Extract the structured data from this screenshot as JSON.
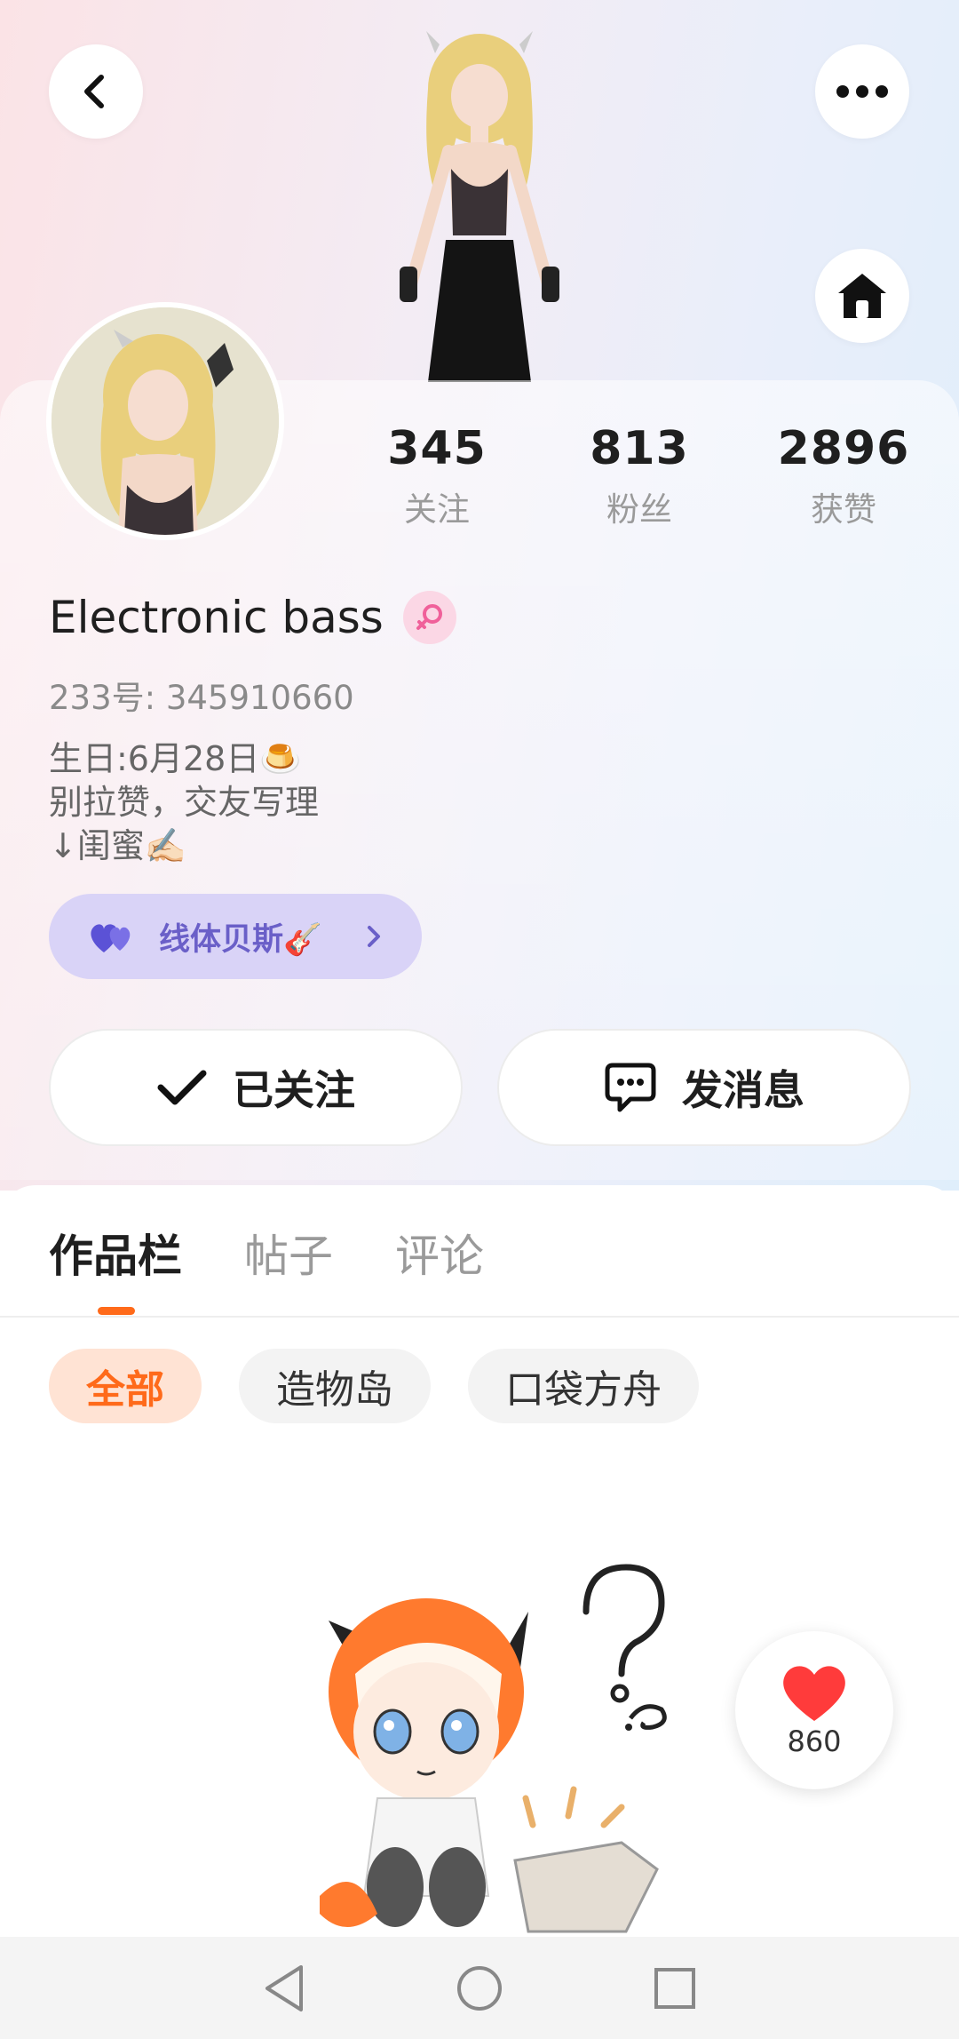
{
  "header": {
    "back_icon": "chevron-left-icon",
    "more_icon": "more-horizontal-icon",
    "home_icon": "home-icon"
  },
  "profile": {
    "name": "Electronic bass",
    "gender_icon": "female-icon",
    "uid": "233号:  345910660",
    "bio_lines": [
      "生日:6月28日🍮",
      "别拉赞，交友写理",
      "↓闺蜜✍🏻"
    ],
    "stats": [
      {
        "value": "345",
        "label": "关注"
      },
      {
        "value": "813",
        "label": "粉丝"
      },
      {
        "value": "2896",
        "label": "获赞"
      }
    ],
    "relation_tag": "线体贝斯🎸",
    "relation_icon": "hearts-icon"
  },
  "actions": {
    "follow_label": "已关注",
    "message_label": "发消息"
  },
  "tabs": [
    {
      "label": "作品栏",
      "active": true
    },
    {
      "label": "帖子",
      "active": false
    },
    {
      "label": "评论",
      "active": false
    }
  ],
  "filters": [
    {
      "label": "全部",
      "active": true
    },
    {
      "label": "造物岛",
      "active": false
    },
    {
      "label": "口袋方舟",
      "active": false
    }
  ],
  "like": {
    "count": "860"
  },
  "colors": {
    "accent": "#ff6a1a",
    "tag_bg": "#d9d3f7",
    "tag_text": "#6a5fc8",
    "heart": "#ff3b3b"
  }
}
